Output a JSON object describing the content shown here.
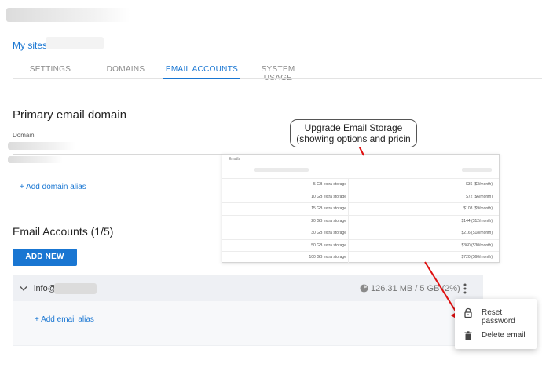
{
  "breadcrumb": {
    "root": "My sites",
    "separator": "/"
  },
  "tabs": [
    {
      "label": "SETTINGS"
    },
    {
      "label": "DOMAINS"
    },
    {
      "label": "EMAIL ACCOUNTS"
    },
    {
      "label": "SYSTEM USAGE"
    }
  ],
  "primary_domain": {
    "title": "Primary email domain",
    "domain_label": "Domain",
    "add_alias": "+ Add domain alias"
  },
  "email_accounts": {
    "title": "Email Accounts (1/5)",
    "add_button": "ADD NEW EMAIL",
    "account_prefix": "info@",
    "usage": "126.31 MB / 5 GB (2%)",
    "add_email_alias": "+ Add email alias"
  },
  "callout": {
    "line1": "Upgrade Email Storage",
    "line2": "(showing options and pricin"
  },
  "storage_table": {
    "header": "Emails",
    "rows": [
      {
        "option": "5 GB extra storage",
        "price": "$36 ($3/month)"
      },
      {
        "option": "10 GB extra storage",
        "price": "$72 ($6/month)"
      },
      {
        "option": "15 GB extra storage",
        "price": "$108 ($9/month)"
      },
      {
        "option": "20 GB extra storage",
        "price": "$144 ($12/month)"
      },
      {
        "option": "30 GB extra storage",
        "price": "$216 ($18/month)"
      },
      {
        "option": "50 GB extra storage",
        "price": "$360 ($30/month)"
      },
      {
        "option": "100 GB extra storage",
        "price": "$720 ($60/month)"
      }
    ]
  },
  "context_menu": {
    "items": [
      {
        "label": "Reset password",
        "icon": "lock-icon"
      },
      {
        "label": "Delete email",
        "icon": "trash-icon"
      }
    ]
  },
  "colors": {
    "accent": "#1976d2",
    "annotation": "#e01010"
  }
}
